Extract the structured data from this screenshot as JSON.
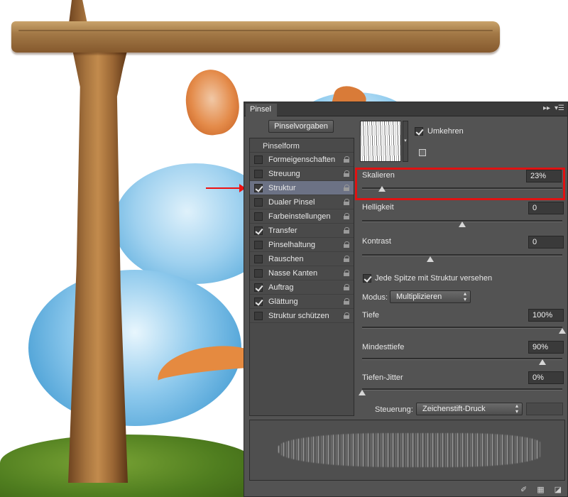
{
  "panel": {
    "tab_title": "Pinsel",
    "header_icons": [
      "collapse-icon",
      "panel-menu-icon"
    ],
    "brush_presets_button": "Pinselvorgaben",
    "list_header": "Pinselform",
    "items": [
      {
        "label": "Formeigenschaften",
        "checked": false,
        "selected": false
      },
      {
        "label": "Streuung",
        "checked": false,
        "selected": false
      },
      {
        "label": "Struktur",
        "checked": true,
        "selected": true
      },
      {
        "label": "Dualer Pinsel",
        "checked": false,
        "selected": false
      },
      {
        "label": "Farbeinstellungen",
        "checked": false,
        "selected": false
      },
      {
        "label": "Transfer",
        "checked": true,
        "selected": false
      },
      {
        "label": "Pinselhaltung",
        "checked": false,
        "selected": false
      },
      {
        "label": "Rauschen",
        "checked": false,
        "selected": false
      },
      {
        "label": "Nasse Kanten",
        "checked": false,
        "selected": false
      },
      {
        "label": "Auftrag",
        "checked": true,
        "selected": false
      },
      {
        "label": "Glättung",
        "checked": true,
        "selected": false
      },
      {
        "label": "Struktur schützen",
        "checked": false,
        "selected": false
      }
    ]
  },
  "texture": {
    "invert_label": "Umkehren",
    "invert_checked": true
  },
  "params": {
    "scale": {
      "label": "Skalieren",
      "value": "23%",
      "slider": 0.1
    },
    "brightness": {
      "label": "Helligkeit",
      "value": "0",
      "slider": 0.5
    },
    "contrast": {
      "label": "Kontrast",
      "value": "0",
      "slider": 0.34
    },
    "each_tip_label": "Jede Spitze mit Struktur versehen",
    "each_tip_checked": true,
    "mode_label": "Modus:",
    "mode_value": "Multiplizieren",
    "depth": {
      "label": "Tiefe",
      "value": "100%",
      "slider": 1.0
    },
    "min_depth": {
      "label": "Mindesttiefe",
      "value": "90%",
      "slider": 0.9
    },
    "depth_jitter": {
      "label": "Tiefen-Jitter",
      "value": "0%",
      "slider": 0.0
    },
    "control_label": "Steuerung:",
    "control_value": "Zeichenstift-Druck"
  },
  "footer_icons": [
    "toggle-live-tip-icon",
    "grid-icon",
    "new-preset-icon"
  ],
  "colors": {
    "panel_bg": "#535353",
    "selected_row": "#6c7285",
    "highlight": "#e01212"
  }
}
